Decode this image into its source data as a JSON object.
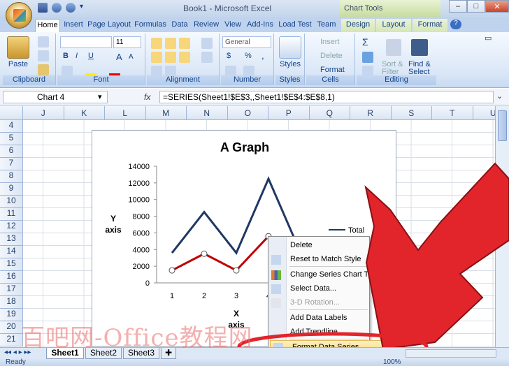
{
  "window": {
    "title": "Book1 - Microsoft Excel",
    "context_title": "Chart Tools",
    "controls": [
      "–",
      "□",
      "✕"
    ]
  },
  "ribbon": {
    "tabs": [
      "Home",
      "Insert",
      "Page Layout",
      "Formulas",
      "Data",
      "Review",
      "View",
      "Add-Ins",
      "Load Test",
      "Team",
      "Design",
      "Layout",
      "Format"
    ],
    "active_tab": "Home",
    "clipboard": {
      "label": "Clipboard",
      "paste": "Paste"
    },
    "font": {
      "label": "Font",
      "size": "11",
      "bold": "B",
      "italic": "I",
      "underline": "U",
      "grow": "A",
      "shrink": "A"
    },
    "alignment": {
      "label": "Alignment"
    },
    "number": {
      "label": "Number",
      "format": "General",
      "currency": "$",
      "percent": "%",
      "comma": ","
    },
    "styles": {
      "label": "Styles"
    },
    "cells": {
      "label": "Cells",
      "insert": "Insert",
      "delete": "Delete",
      "format": "Format"
    },
    "editing": {
      "label": "Editing",
      "sigma": "Σ",
      "sort": "Sort &",
      "sort2": "Filter",
      "find": "Find &",
      "find2": "Select"
    }
  },
  "formula_bar": {
    "name_box": "Chart 4",
    "fx": "fx",
    "formula": "=SERIES(Sheet1!$E$3,,Sheet1!$E$4:$E$8,1)"
  },
  "columns": [
    "J",
    "K",
    "L",
    "M",
    "N",
    "O",
    "P",
    "Q",
    "R",
    "S",
    "T",
    "U"
  ],
  "rows": [
    "4",
    "5",
    "6",
    "7",
    "8",
    "9",
    "10",
    "11",
    "12",
    "13",
    "14",
    "15",
    "16",
    "17",
    "18",
    "19",
    "20",
    "21"
  ],
  "chart_data": {
    "type": "line",
    "title": "A Graph",
    "xlabel": "X\naxis",
    "ylabel": "Y\naxis",
    "categories": [
      1,
      2,
      3,
      4,
      5
    ],
    "ylim": [
      0,
      14000
    ],
    "yticks": [
      0,
      2000,
      4000,
      6000,
      8000,
      10000,
      12000,
      14000
    ],
    "series": [
      {
        "name": "Total",
        "values": [
          3600,
          8500,
          3600,
          12500,
          3600
        ],
        "color": "#1f3864"
      },
      {
        "values": [
          1500,
          3500,
          1500,
          5600,
          3500
        ],
        "color": "#c00000",
        "selected": true
      }
    ],
    "legend": [
      "Total"
    ],
    "legend_position": "right"
  },
  "context_menu": {
    "items": [
      {
        "label": "Delete",
        "disabled": false
      },
      {
        "label": "Reset to Match Style",
        "disabled": false
      },
      {
        "label": "Change Series Chart Type...",
        "disabled": false
      },
      {
        "label": "Select Data...",
        "disabled": false
      },
      {
        "label": "3-D Rotation...",
        "disabled": true
      },
      {
        "label": "Add Data Labels",
        "disabled": false
      },
      {
        "label": "Add Trendline...",
        "disabled": false
      },
      {
        "label": "Format Data Series...",
        "disabled": false,
        "highlighted": true
      }
    ]
  },
  "sheet_tabs": [
    "Sheet1",
    "Sheet2",
    "Sheet3"
  ],
  "active_sheet": "Sheet1",
  "status": {
    "left": "Ready",
    "zoom": "100%"
  },
  "watermark": "百吧网-Office教程网",
  "annotation": {
    "arrow_color": "#e2252b",
    "ellipse_color": "#e2252b"
  }
}
